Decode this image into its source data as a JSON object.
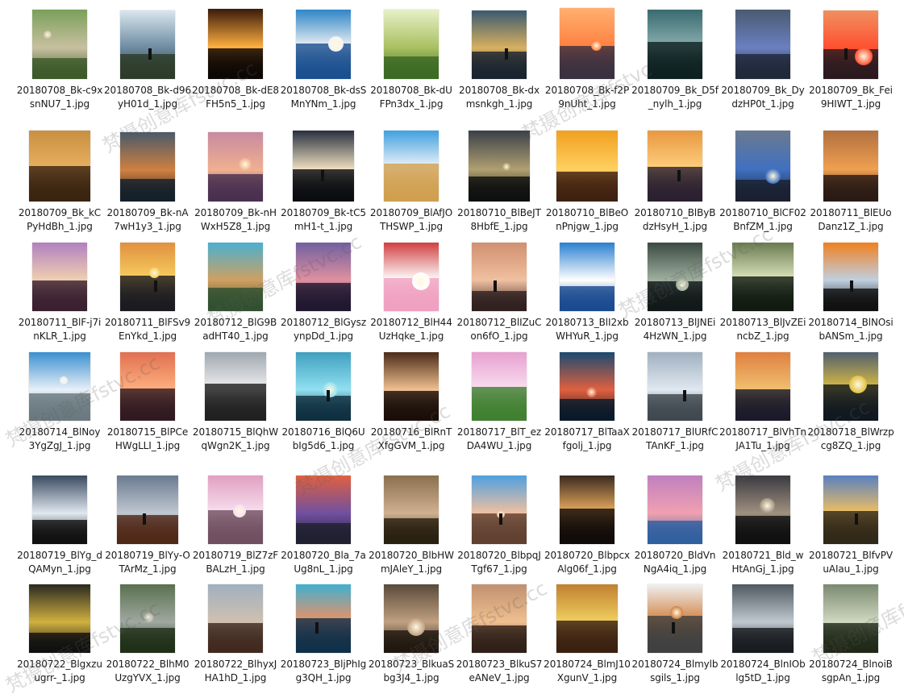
{
  "colors": {
    "background": "#ffffff",
    "text": "#1a1a1a"
  },
  "files": [
    {
      "name": "20180708_Bk-c9xsnNU7_1.jpg",
      "palette": [
        "#7aa05a",
        "#3e5a2a",
        "#c8c0a0"
      ],
      "h": 0.96,
      "w": 0.76
    },
    {
      "name": "20180708_Bk-d96yH01d_1.jpg",
      "palette": [
        "#d8e6ee",
        "#2d3c2a",
        "#6c8aa0"
      ],
      "h": 0.94,
      "w": 0.76
    },
    {
      "name": "20180708_Bk-dE8FH5n5_1.jpg",
      "palette": [
        "#3a1a0a",
        "#0c0604",
        "#ffb040"
      ],
      "h": 0.97,
      "w": 0.76
    },
    {
      "name": "20180708_Bk-dsSMnYNm_1.jpg",
      "palette": [
        "#2e86c8",
        "#1a5090",
        "#f4f4f4"
      ],
      "h": 0.96,
      "w": 0.76
    },
    {
      "name": "20180708_Bk-dUFPn3dx_1.jpg",
      "palette": [
        "#e8f0c8",
        "#3c6a24",
        "#a8c060"
      ],
      "h": 0.96,
      "w": 0.76
    },
    {
      "name": "20180708_Bk-dxmsnkgh_1.jpg",
      "palette": [
        "#3a5a70",
        "#1a2430",
        "#d8b060"
      ],
      "h": 0.94,
      "w": 0.76
    },
    {
      "name": "20180708_Bk-f2P9nUht_1.jpg",
      "palette": [
        "#ffb070",
        "#3a3040",
        "#ff8040"
      ],
      "h": 0.98,
      "w": 0.76
    },
    {
      "name": "20180709_Bk_D5f_nylh_1.jpg",
      "palette": [
        "#3a6a70",
        "#0e2020",
        "#8ab0b0"
      ],
      "h": 0.96,
      "w": 0.76
    },
    {
      "name": "20180709_Bk_DydzHP0t_1.jpg",
      "palette": [
        "#4a5a70",
        "#20283a",
        "#6a80c0"
      ],
      "h": 0.96,
      "w": 0.76
    },
    {
      "name": "20180709_Bk_Fei9HIWT_1.jpg",
      "palette": [
        "#f09060",
        "#2a1a20",
        "#ff5030"
      ],
      "h": 0.94,
      "w": 0.76
    },
    {
      "name": "20180709_Bk_kCPyHdBh_1.jpg",
      "palette": [
        "#c89040",
        "#3a2410",
        "#e8b060"
      ],
      "h": 0.98,
      "w": 0.84
    },
    {
      "name": "20180709_Bk-nA7wH1y3_1.jpg",
      "palette": [
        "#4a5a6a",
        "#14202a",
        "#d08040"
      ],
      "h": 0.96,
      "w": 0.76
    },
    {
      "name": "20180709_Bk-nHWxH5Z8_1.jpg",
      "palette": [
        "#c88aa0",
        "#4a3050",
        "#f0b090"
      ],
      "h": 0.96,
      "w": 0.76
    },
    {
      "name": "20180709_Bk-tC5mH1-t_1.jpg",
      "palette": [
        "#283040",
        "#0a0c10",
        "#f0e0c0"
      ],
      "h": 0.98,
      "w": 0.84
    },
    {
      "name": "20180709_BlAfJOTHSWP_1.jpg",
      "palette": [
        "#40a0e0",
        "#d0a050",
        "#f8f8f8"
      ],
      "h": 0.98,
      "w": 0.76
    },
    {
      "name": "20180710_BlBeJT8HbfE_1.jpg",
      "palette": [
        "#3a4048",
        "#0e1010",
        "#b0a070"
      ],
      "h": 0.98,
      "w": 0.84
    },
    {
      "name": "20180710_BlBeOnPnjgw_1.jpg",
      "palette": [
        "#f0a020",
        "#402010",
        "#ffd060"
      ],
      "h": 0.98,
      "w": 0.84
    },
    {
      "name": "20180710_BlByBdzHsyH_1.jpg",
      "palette": [
        "#e89840",
        "#2a2030",
        "#ffd080"
      ],
      "h": 0.98,
      "w": 0.76
    },
    {
      "name": "20180710_BlCF02BnfZM_1.jpg",
      "palette": [
        "#6a7a90",
        "#1a2030",
        "#4070c0"
      ],
      "h": 0.98,
      "w": 0.76
    },
    {
      "name": "20180711_BlEUoDanz1Z_1.jpg",
      "palette": [
        "#b07040",
        "#2a1a14",
        "#f0a050"
      ],
      "h": 0.98,
      "w": 0.76
    },
    {
      "name": "20180711_BlF-j7inKLR_1.jpg",
      "palette": [
        "#b080c0",
        "#3a2030",
        "#f0d0b0"
      ],
      "h": 0.94,
      "w": 0.76
    },
    {
      "name": "20180711_BlFSv9EnYkd_1.jpg",
      "palette": [
        "#e09040",
        "#1a1a20",
        "#f8d060"
      ],
      "h": 0.94,
      "w": 0.76
    },
    {
      "name": "20180712_BlG9BadHT40_1.jpg",
      "palette": [
        "#4ab0d0",
        "#305030",
        "#d0a060"
      ],
      "h": 0.94,
      "w": 0.76
    },
    {
      "name": "20180712_BlGyszynpDd_1.jpg",
      "palette": [
        "#7060a0",
        "#201830",
        "#e090a0"
      ],
      "h": 0.94,
      "w": 0.76
    },
    {
      "name": "20180712_BlH44UzHqke_1.jpg",
      "palette": [
        "#d04040",
        "#f0a0c0",
        "#ffffff"
      ],
      "h": 0.94,
      "w": 0.76
    },
    {
      "name": "20180712_BlIZuCon6fO_1.jpg",
      "palette": [
        "#d09070",
        "#302020",
        "#f0c0a0"
      ],
      "h": 0.94,
      "w": 0.76
    },
    {
      "name": "20180713_BlI2xbWHYuR_1.jpg",
      "palette": [
        "#2a80d0",
        "#1a4a90",
        "#ffffff"
      ],
      "h": 0.94,
      "w": 0.76
    },
    {
      "name": "20180713_BlJNEi4HzWN_1.jpg",
      "palette": [
        "#3a4a40",
        "#101818",
        "#a0b0a0"
      ],
      "h": 0.94,
      "w": 0.76
    },
    {
      "name": "20180713_BlJvZEincbZ_1.jpg",
      "palette": [
        "#6a7a50",
        "#101a10",
        "#e0e8c0"
      ],
      "h": 0.94,
      "w": 0.84
    },
    {
      "name": "20180714_BlNOsibANSm_1.jpg",
      "palette": [
        "#f08020",
        "#101010",
        "#c0d0e0"
      ],
      "h": 0.94,
      "w": 0.76
    },
    {
      "name": "20180714_BlNoy3YgZgJ_1.jpg",
      "palette": [
        "#3a90d0",
        "#6a7a80",
        "#e8f0f8"
      ],
      "h": 0.94,
      "w": 0.84
    },
    {
      "name": "20180715_BlPCeHWgLLI_1.jpg",
      "palette": [
        "#e07050",
        "#301a20",
        "#ffb080"
      ],
      "h": 0.94,
      "w": 0.76
    },
    {
      "name": "20180715_BlQhWqWgn2K_1.jpg",
      "palette": [
        "#a0a8b0",
        "#202020",
        "#f0f0f0"
      ],
      "h": 0.94,
      "w": 0.84
    },
    {
      "name": "20180716_BlQ6UbIg5d6_1.jpg",
      "palette": [
        "#40a0c0",
        "#103040",
        "#90e0f0"
      ],
      "h": 0.94,
      "w": 0.76
    },
    {
      "name": "20180716_BlRnTXfgGVM_1.jpg",
      "palette": [
        "#4a2a18",
        "#1a0e08",
        "#f0c090"
      ],
      "h": 0.94,
      "w": 0.76
    },
    {
      "name": "20180717_BlT_ezDA4WU_1.jpg",
      "palette": [
        "#e8a0d0",
        "#408030",
        "#f8e0f0"
      ],
      "h": 0.94,
      "w": 0.76
    },
    {
      "name": "20180717_BlTaaXfgolj_1.jpg",
      "palette": [
        "#1a4a70",
        "#0a1a2a",
        "#e06040"
      ],
      "h": 0.94,
      "w": 0.76
    },
    {
      "name": "20180717_BlURfCTAnKF_1.jpg",
      "palette": [
        "#a0b0c0",
        "#404850",
        "#e0e8f0"
      ],
      "h": 0.94,
      "w": 0.76
    },
    {
      "name": "20180717_BlVhTnJA1Tu_1.jpg",
      "palette": [
        "#e08040",
        "#1a1a2a",
        "#f0c070"
      ],
      "h": 0.94,
      "w": 0.76
    },
    {
      "name": "20180718_BlWrzpcg8ZQ_1.jpg",
      "palette": [
        "#506070",
        "#101820",
        "#e0c040"
      ],
      "h": 0.94,
      "w": 0.76
    },
    {
      "name": "20180719_BlYg_dQAMyn_1.jpg",
      "palette": [
        "#3a4a60",
        "#101010",
        "#e0e8f0"
      ],
      "h": 0.94,
      "w": 0.76
    },
    {
      "name": "20180719_BlYy-OTArMz_1.jpg",
      "palette": [
        "#6a7a90",
        "#502818",
        "#c0c8d0"
      ],
      "h": 0.94,
      "w": 0.84
    },
    {
      "name": "20180719_BlZ7zFBALzH_1.jpg",
      "palette": [
        "#e0a0c0",
        "#705060",
        "#f8e0f0"
      ],
      "h": 0.94,
      "w": 0.76
    },
    {
      "name": "20180720_Bla_7aUg8nL_1.jpg",
      "palette": [
        "#e06040",
        "#202030",
        "#7050a0"
      ],
      "h": 0.94,
      "w": 0.76
    },
    {
      "name": "20180720_BlbHWmJAleY_1.jpg",
      "palette": [
        "#8a7050",
        "#2a2010",
        "#d0b090"
      ],
      "h": 0.94,
      "w": 0.76
    },
    {
      "name": "20180720_BlbpqJTgf67_1.jpg",
      "palette": [
        "#50a0e0",
        "#604030",
        "#f0c0a0"
      ],
      "h": 0.94,
      "w": 0.76
    },
    {
      "name": "20180720_BlbpcxAlg06f_1.jpg",
      "palette": [
        "#3a2a20",
        "#100a08",
        "#f0b060"
      ],
      "h": 0.94,
      "w": 0.76
    },
    {
      "name": "20180720_BldVnNgA4iq_1.jpg",
      "palette": [
        "#c080c0",
        "#3060a0",
        "#f0a0b0"
      ],
      "h": 0.94,
      "w": 0.76
    },
    {
      "name": "20180721_Bld_wHtAnGj_1.jpg",
      "palette": [
        "#3a3a40",
        "#101010",
        "#a09080"
      ],
      "h": 0.94,
      "w": 0.76
    },
    {
      "name": "20180721_BlfvPVuAIau_1.jpg",
      "palette": [
        "#5a80c0",
        "#302818",
        "#f0c060"
      ],
      "h": 0.94,
      "w": 0.76
    },
    {
      "name": "20180722_Blgxzuugrr-_1.jpg",
      "palette": [
        "#2a2a20",
        "#101010",
        "#d0b040"
      ],
      "h": 0.94,
      "w": 0.84
    },
    {
      "name": "20180722_BlhM0UzgYVX_1.jpg",
      "palette": [
        "#5a7050",
        "#203018",
        "#a0a8a0"
      ],
      "h": 0.94,
      "w": 0.76
    },
    {
      "name": "20180722_BlhyxJHA1hD_1.jpg",
      "palette": [
        "#a0b0c0",
        "#402a20",
        "#d0c0b0"
      ],
      "h": 0.94,
      "w": 0.76
    },
    {
      "name": "20180723_BljPhIgg3QH_1.jpg",
      "palette": [
        "#40b0d0",
        "#10304a",
        "#f09060"
      ],
      "h": 0.94,
      "w": 0.76
    },
    {
      "name": "20180723_BlkuaSbg3J4_1.jpg",
      "palette": [
        "#5a4a3a",
        "#201810",
        "#c0a080"
      ],
      "h": 0.94,
      "w": 0.76
    },
    {
      "name": "20180723_BlkuS7eANeV_1.jpg",
      "palette": [
        "#c09070",
        "#302018",
        "#f0c090"
      ],
      "h": 0.94,
      "w": 0.76
    },
    {
      "name": "20180724_BlmJ10XgunV_1.jpg",
      "palette": [
        "#c08030",
        "#3a2010",
        "#f0d060"
      ],
      "h": 0.94,
      "w": 0.84
    },
    {
      "name": "20180724_Blmylbsgils_1.jpg",
      "palette": [
        "#f0f0f0",
        "#404040",
        "#d08040"
      ],
      "h": 0.94,
      "w": 0.76
    },
    {
      "name": "20180724_BlnIOblg5tD_1.jpg",
      "palette": [
        "#505860",
        "#181c20",
        "#c0c8d0"
      ],
      "h": 0.94,
      "w": 0.84
    },
    {
      "name": "20180724_BlnoiBsgpAn_1.jpg",
      "palette": [
        "#7a8a70",
        "#202818",
        "#d0d8c0"
      ],
      "h": 0.94,
      "w": 0.76
    }
  ],
  "watermarks": [
    {
      "text": "梵摄创意库fstvc.cc"
    },
    {
      "text": "梵摄创意库fstvc"
    },
    {
      "text": "梵摄创意库fstvc.cc"
    },
    {
      "text": "梵摄创意库fstvc.cc"
    },
    {
      "text": "梵摄创意库fstvc.cc"
    },
    {
      "text": "梵摄创意库fstvc.cc"
    },
    {
      "text": "梵摄创意库fstvc.cc"
    },
    {
      "text": "梵摄创意库fstvc.cc"
    },
    {
      "text": "梵摄创意库fstvc.cc"
    },
    {
      "text": "梵摄创意库fstvc.cc"
    }
  ]
}
